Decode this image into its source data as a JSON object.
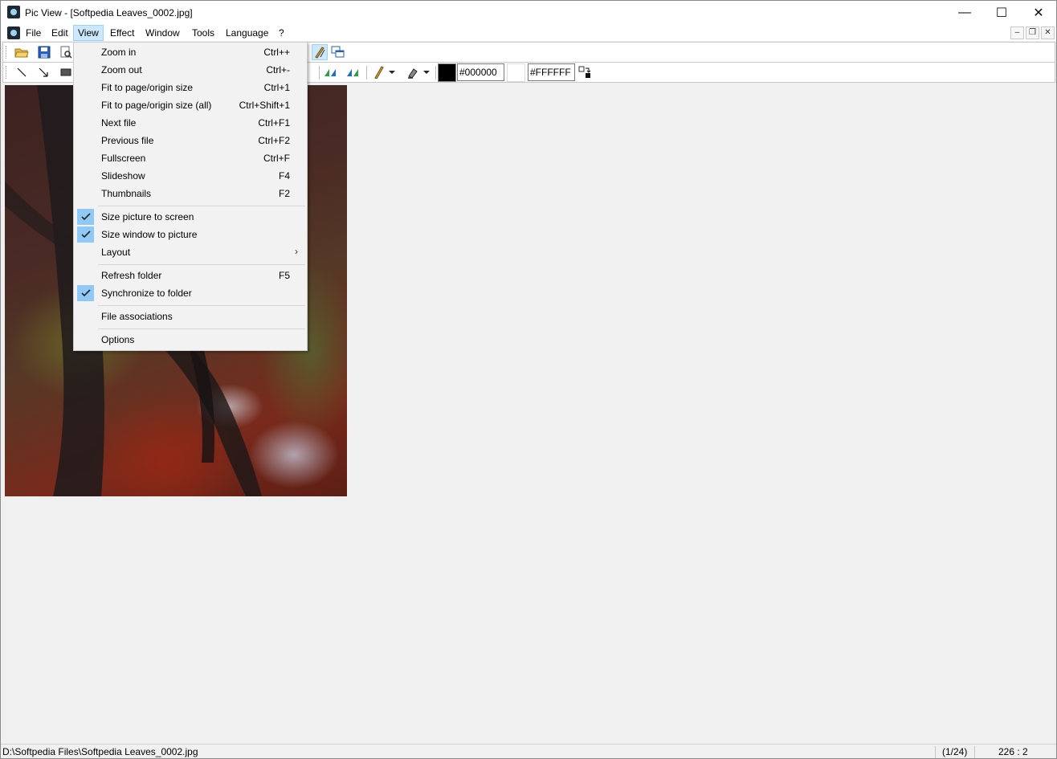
{
  "window": {
    "title": "Pic View - [Softpedia Leaves_0002.jpg]",
    "minimize_glyph": "—",
    "maximize_glyph": "☐",
    "close_glyph": "✕"
  },
  "menubar": {
    "items": [
      {
        "label": "File"
      },
      {
        "label": "Edit"
      },
      {
        "label": "View",
        "active": true
      },
      {
        "label": "Effect"
      },
      {
        "label": "Window"
      },
      {
        "label": "Tools"
      },
      {
        "label": "Language"
      },
      {
        "label": "?"
      }
    ],
    "mdi": {
      "minimize": "–",
      "restore": "❐",
      "close": "✕"
    }
  },
  "toolbar": {
    "fg_color": "#000000",
    "bg_color": "#FFFFFF",
    "fg_hex_value": "#000000",
    "bg_hex_value": "#FFFFFF",
    "icons": [
      "open-folder-icon",
      "save-icon",
      "print-preview-icon",
      "brush-active-icon",
      "window-cascade-icon",
      "line-tool-icon",
      "arrow-tool-icon",
      "rectangle-tool-icon",
      "flip-left-icon",
      "flip-right-icon",
      "pencil-icon",
      "fill-icon",
      "swap-colors-icon"
    ]
  },
  "view_menu": {
    "items": [
      {
        "label": "Zoom in",
        "shortcut": "Ctrl++"
      },
      {
        "label": "Zoom out",
        "shortcut": "Ctrl+-"
      },
      {
        "label": "Fit to page/origin size",
        "shortcut": "Ctrl+1"
      },
      {
        "label": "Fit to page/origin size (all)",
        "shortcut": "Ctrl+Shift+1"
      },
      {
        "label": "Next file",
        "shortcut": "Ctrl+F1"
      },
      {
        "label": "Previous file",
        "shortcut": "Ctrl+F2"
      },
      {
        "label": "Fullscreen",
        "shortcut": "Ctrl+F"
      },
      {
        "label": "Slideshow",
        "shortcut": "F4"
      },
      {
        "label": "Thumbnails",
        "shortcut": "F2"
      },
      {
        "label": "Size picture to screen",
        "checked": true
      },
      {
        "label": "Size window to picture",
        "checked": true
      },
      {
        "label": "Layout",
        "submenu": true,
        "arrow": "›"
      },
      {
        "label": "Refresh folder",
        "shortcut": "F5"
      },
      {
        "label": "Synchronize to folder",
        "checked": true
      },
      {
        "label": "File associations"
      },
      {
        "label": "Options"
      }
    ]
  },
  "statusbar": {
    "path": "D:\\Softpedia Files\\Softpedia Leaves_0002.jpg",
    "file_count": "(1/24)",
    "zoom": "226 : 2"
  }
}
